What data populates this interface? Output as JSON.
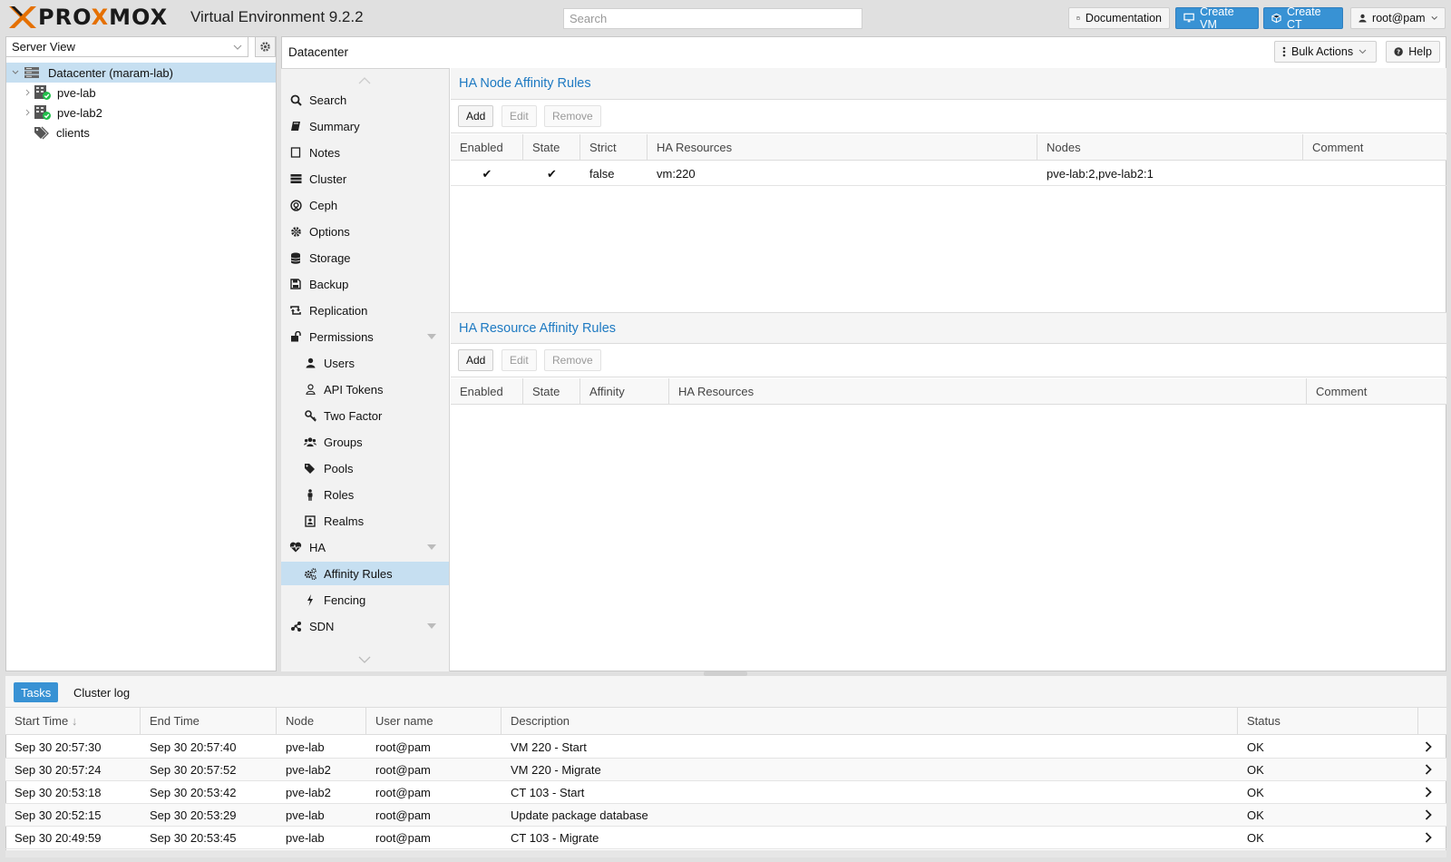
{
  "header": {
    "logo": "PROXMOX",
    "version": "Virtual Environment 9.2.2",
    "search_placeholder": "Search",
    "documentation_label": "Documentation",
    "create_vm_label": "Create VM",
    "create_ct_label": "Create CT",
    "user_label": "root@pam"
  },
  "tree": {
    "view_label": "Server View",
    "items": [
      {
        "label": "Datacenter (maram-lab)",
        "icon": "datacenter-icon"
      },
      {
        "label": "pve-lab",
        "icon": "node-online-icon"
      },
      {
        "label": "pve-lab2",
        "icon": "node-online-icon"
      },
      {
        "label": "clients",
        "icon": "tags-icon"
      }
    ]
  },
  "content": {
    "breadcrumb": "Datacenter",
    "bulk_actions_label": "Bulk Actions",
    "help_label": "Help"
  },
  "nav": {
    "items": [
      {
        "label": "Search",
        "icon": "search-icon"
      },
      {
        "label": "Summary",
        "icon": "book-icon"
      },
      {
        "label": "Notes",
        "icon": "notes-icon"
      },
      {
        "label": "Cluster",
        "icon": "cluster-icon"
      },
      {
        "label": "Ceph",
        "icon": "ceph-icon"
      },
      {
        "label": "Options",
        "icon": "gear-icon"
      },
      {
        "label": "Storage",
        "icon": "database-icon"
      },
      {
        "label": "Backup",
        "icon": "floppy-icon"
      },
      {
        "label": "Replication",
        "icon": "retweet-icon"
      },
      {
        "label": "Permissions",
        "icon": "unlock-icon"
      },
      {
        "label": "Users",
        "icon": "user-icon"
      },
      {
        "label": "API Tokens",
        "icon": "user-outline-icon"
      },
      {
        "label": "Two Factor",
        "icon": "key-icon"
      },
      {
        "label": "Groups",
        "icon": "users-icon"
      },
      {
        "label": "Pools",
        "icon": "tags-icon"
      },
      {
        "label": "Roles",
        "icon": "male-icon"
      },
      {
        "label": "Realms",
        "icon": "address-book-icon"
      },
      {
        "label": "HA",
        "icon": "heartbeat-icon"
      },
      {
        "label": "Affinity Rules",
        "icon": "gears-icon"
      },
      {
        "label": "Fencing",
        "icon": "bolt-icon"
      },
      {
        "label": "SDN",
        "icon": "sdn-icon"
      }
    ]
  },
  "node_rules": {
    "title": "HA Node Affinity Rules",
    "add_label": "Add",
    "edit_label": "Edit",
    "remove_label": "Remove",
    "columns": [
      "Enabled",
      "State",
      "Strict",
      "HA Resources",
      "Nodes",
      "Comment"
    ],
    "rows": [
      {
        "enabled": "✔",
        "state": "✔",
        "strict": "false",
        "resources": "vm:220",
        "nodes": "pve-lab:2,pve-lab2:1",
        "comment": ""
      }
    ]
  },
  "resource_rules": {
    "title": "HA Resource Affinity Rules",
    "add_label": "Add",
    "edit_label": "Edit",
    "remove_label": "Remove",
    "columns": [
      "Enabled",
      "State",
      "Affinity",
      "HA Resources",
      "Comment"
    ],
    "rows": []
  },
  "tasks": {
    "tabs": [
      "Tasks",
      "Cluster log"
    ],
    "columns": [
      "Start Time",
      "End Time",
      "Node",
      "User name",
      "Description",
      "Status"
    ],
    "sort_indicator": "↓",
    "rows": [
      {
        "start": "Sep 30 20:57:30",
        "end": "Sep 30 20:57:40",
        "node": "pve-lab",
        "user": "root@pam",
        "desc": "VM 220 - Start",
        "status": "OK"
      },
      {
        "start": "Sep 30 20:57:24",
        "end": "Sep 30 20:57:52",
        "node": "pve-lab2",
        "user": "root@pam",
        "desc": "VM 220 - Migrate",
        "status": "OK"
      },
      {
        "start": "Sep 30 20:53:18",
        "end": "Sep 30 20:53:42",
        "node": "pve-lab2",
        "user": "root@pam",
        "desc": "CT 103 - Start",
        "status": "OK"
      },
      {
        "start": "Sep 30 20:52:15",
        "end": "Sep 30 20:53:29",
        "node": "pve-lab",
        "user": "root@pam",
        "desc": "Update package database",
        "status": "OK"
      },
      {
        "start": "Sep 30 20:49:59",
        "end": "Sep 30 20:53:45",
        "node": "pve-lab",
        "user": "root@pam",
        "desc": "CT 103 - Migrate",
        "status": "OK"
      }
    ]
  },
  "colors": {
    "accent": "#3892d4",
    "title_blue": "#1e7ac2",
    "selection": "#c6dff1",
    "logo_orange": "#e57000",
    "online_green": "#21bf4b"
  }
}
